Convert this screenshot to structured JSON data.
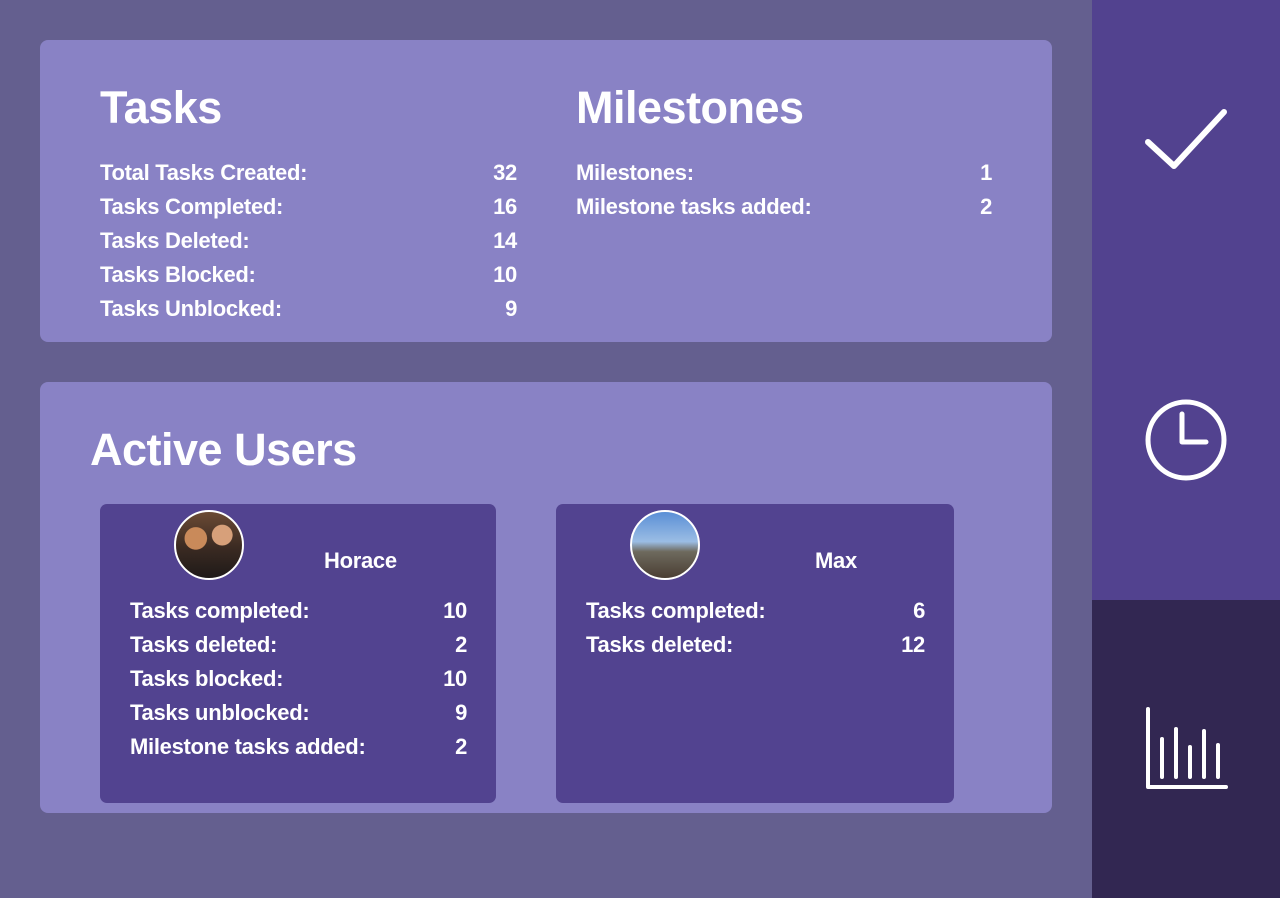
{
  "tasks": {
    "title": "Tasks",
    "rows": [
      {
        "label": "Total Tasks Created:",
        "value": "32"
      },
      {
        "label": "Tasks Completed:",
        "value": "16"
      },
      {
        "label": "Tasks Deleted:",
        "value": "14"
      },
      {
        "label": "Tasks Blocked:",
        "value": "10"
      },
      {
        "label": "Tasks Unblocked:",
        "value": "9"
      }
    ]
  },
  "milestones": {
    "title": "Milestones",
    "rows": [
      {
        "label": "Milestones:",
        "value": "1"
      },
      {
        "label": "Milestone tasks added:",
        "value": "2"
      }
    ]
  },
  "active_users": {
    "title": "Active Users",
    "users": [
      {
        "name": "Horace",
        "rows": [
          {
            "label": "Tasks completed:",
            "value": "10"
          },
          {
            "label": "Tasks deleted:",
            "value": "2"
          },
          {
            "label": "Tasks blocked:",
            "value": "10"
          },
          {
            "label": "Tasks unblocked:",
            "value": "9"
          },
          {
            "label": "Milestone tasks added:",
            "value": "2"
          }
        ]
      },
      {
        "name": "Max",
        "rows": [
          {
            "label": "Tasks completed:",
            "value": "6"
          },
          {
            "label": "Tasks deleted:",
            "value": "12"
          }
        ]
      }
    ]
  },
  "sidebar": {
    "items": [
      {
        "icon": "checkmark-icon",
        "active": false
      },
      {
        "icon": "clock-icon",
        "active": false
      },
      {
        "icon": "bar-chart-icon",
        "active": true
      }
    ]
  },
  "colors": {
    "page_background": "#645f8f",
    "card_background": "#8982c5",
    "user_card_background": "#524390",
    "sidebar_background": "#52428f",
    "sidebar_active_background": "#322752",
    "text": "#ffffff"
  }
}
